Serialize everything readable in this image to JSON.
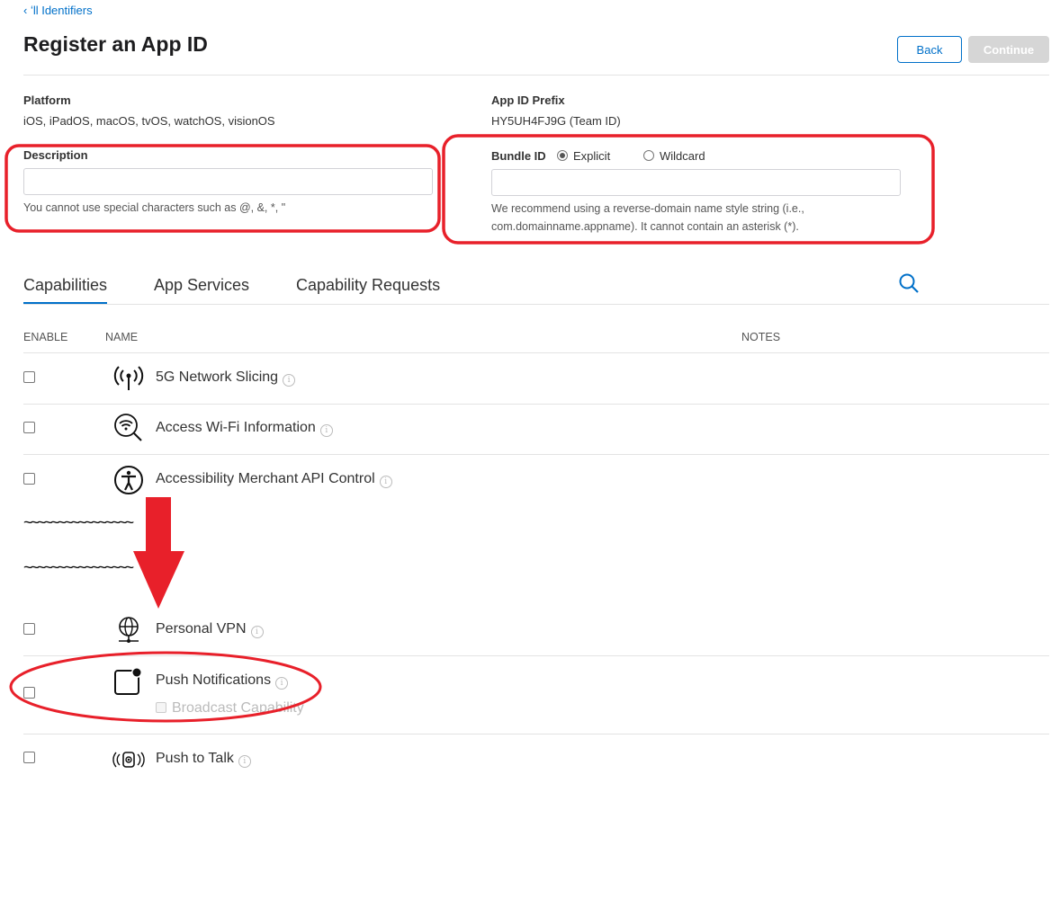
{
  "breadcrumb": {
    "label": "‹ ʻll Identifiers"
  },
  "header": {
    "title": "Register an App ID",
    "back_label": "Back",
    "continue_label": "Continue"
  },
  "platform": {
    "label": "Platform",
    "value": "iOS, iPadOS, macOS, tvOS, watchOS, visionOS"
  },
  "prefix": {
    "label": "App ID Prefix",
    "value": "HY5UH4FJ9G (Team ID)"
  },
  "description": {
    "label": "Description",
    "value": "",
    "help": "You cannot use special characters such as @, &, *, \""
  },
  "bundle": {
    "label": "Bundle ID",
    "explicit": "Explicit",
    "wildcard": "Wildcard",
    "selected": "Explicit",
    "value": "",
    "help1": "We recommend using a reverse-domain name style string (i.e.,",
    "help2": "com.domainname.appname). It cannot contain an asterisk (*)."
  },
  "tabs": [
    {
      "label": "Capabilities",
      "active": true
    },
    {
      "label": "App Services"
    },
    {
      "label": "Capability Requests"
    }
  ],
  "table": {
    "headers": {
      "enable": "ENABLE",
      "name": "NAME",
      "notes": "NOTES"
    },
    "rows": [
      {
        "name": "5G Network Slicing",
        "icon": "antenna-icon"
      },
      {
        "name": "Access Wi-Fi Information",
        "icon": "wifi-search-icon"
      },
      {
        "name": "Accessibility Merchant API Control",
        "icon": "accessibility-icon"
      },
      {
        "name": "Personal VPN",
        "icon": "globe-network-icon"
      },
      {
        "name": "Push Notifications",
        "icon": "notification-badge-icon",
        "sub": "Broadcast Capability"
      },
      {
        "name": "Push to Talk",
        "icon": "walkie-talkie-icon"
      }
    ],
    "elision": "~~~~~~~~~~~~~~~~"
  },
  "info_glyph": "i",
  "colors": {
    "accent": "#0070c9",
    "annotation": "#e8202a"
  }
}
